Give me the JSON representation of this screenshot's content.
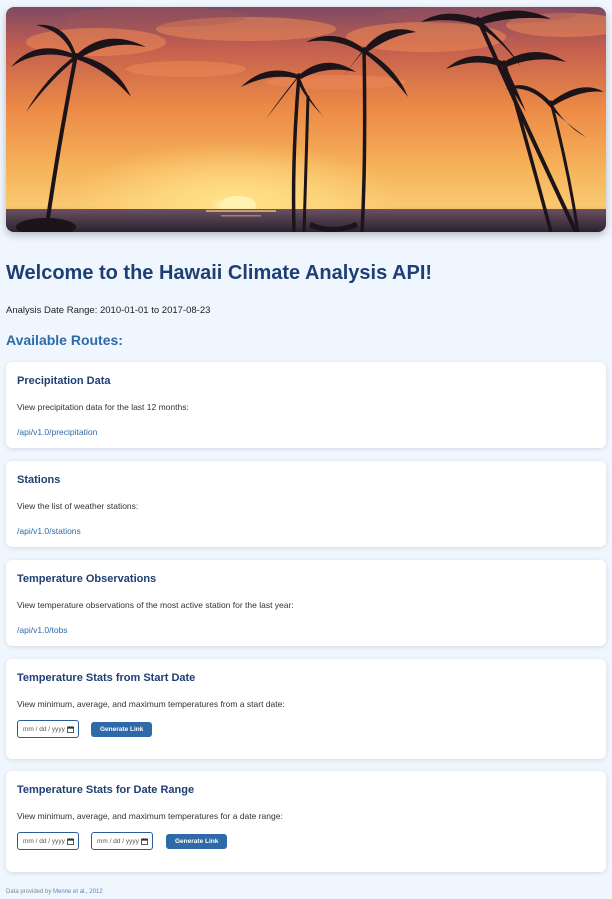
{
  "hero": {
    "image_label": "Tropical sunset with palm trees"
  },
  "page": {
    "title": "Welcome to the Hawaii Climate Analysis API!",
    "date_range_text": "Analysis Date Range: 2010-01-01 to 2017-08-23",
    "routes_heading": "Available Routes:"
  },
  "routes": [
    {
      "title": "Precipitation Data",
      "description": "View precipitation data for the last 12 months:",
      "link": "/api/v1.0/precipitation"
    },
    {
      "title": "Stations",
      "description": "View the list of weather stations:",
      "link": "/api/v1.0/stations"
    },
    {
      "title": "Temperature Observations",
      "description": "View temperature observations of the most active station for the last year:",
      "link": "/api/v1.0/tobs"
    }
  ],
  "stats_start": {
    "title": "Temperature Stats from Start Date",
    "description": "View minimum, average, and maximum temperatures from a start date:",
    "date_placeholder": "mm / dd / yyyy",
    "button_label": "Generate Link"
  },
  "stats_range": {
    "title": "Temperature Stats for Date Range",
    "description": "View minimum, average, and maximum temperatures for a date range:",
    "start_placeholder": "mm / dd / yyyy",
    "end_placeholder": "mm / dd / yyyy",
    "button_label": "Generate Link"
  },
  "footer": {
    "prefix": "Data provided by ",
    "source_link": "Menne et al., 2012"
  },
  "colors": {
    "page_background": "#f0f6fd",
    "title_navy": "#1e3f73",
    "accent_blue": "#2f6aa8",
    "card_background": "#ffffff"
  },
  "icons": [
    "calendar-icon"
  ]
}
